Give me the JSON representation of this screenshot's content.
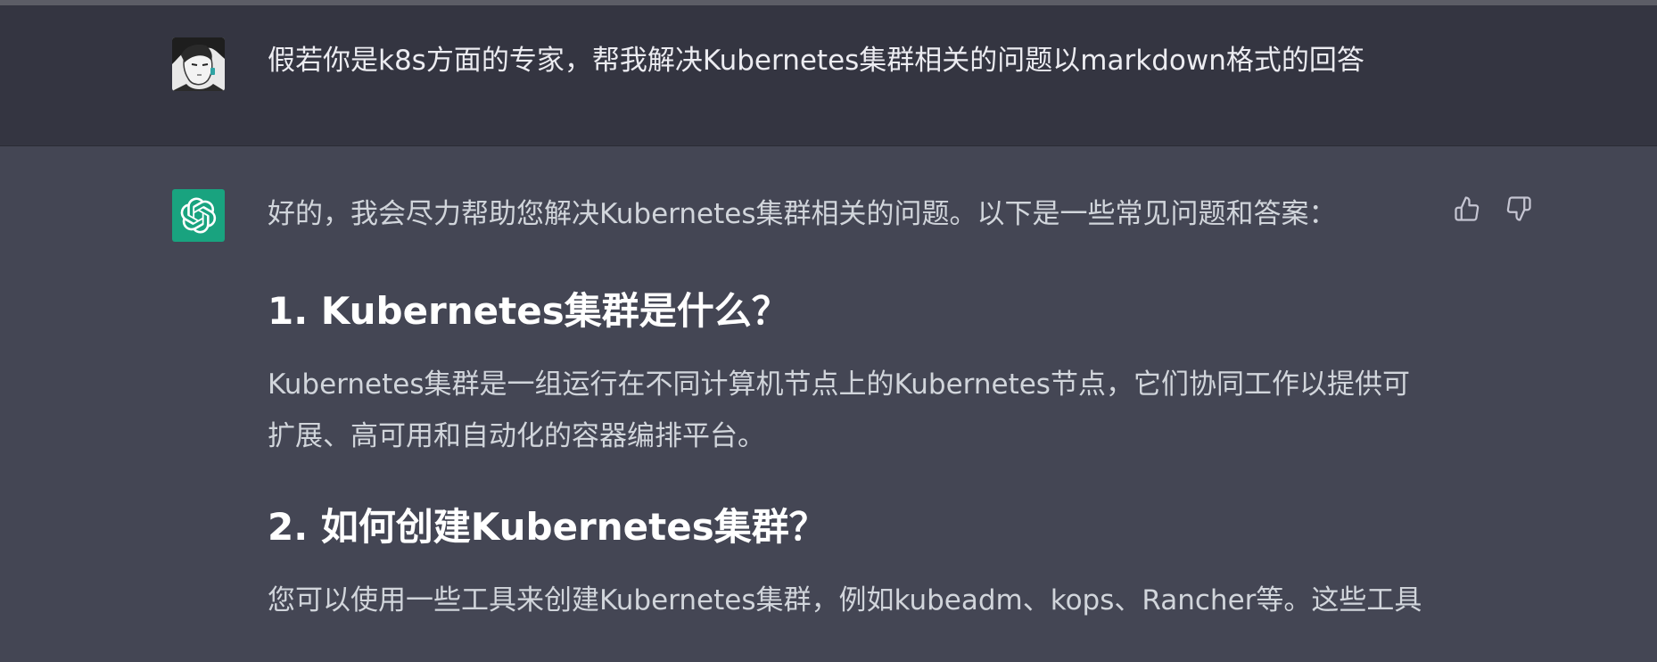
{
  "user_message": {
    "text": "假若你是k8s方面的专家，帮我解决Kubernetes集群相关的问题以markdown格式的回答"
  },
  "assistant_message": {
    "intro": "好的，我会尽力帮助您解决Kubernetes集群相关的问题。以下是一些常见问题和答案：",
    "sections": [
      {
        "heading": "1. Kubernetes集群是什么？",
        "body": "Kubernetes集群是一组运行在不同计算机节点上的Kubernetes节点，它们协同工作以提供可扩展、高可用和自动化的容器编排平台。"
      },
      {
        "heading": "2. 如何创建Kubernetes集群？",
        "body": "您可以使用一些工具来创建Kubernetes集群，例如kubeadm、kops、Rancher等。这些工具"
      }
    ]
  },
  "icons": {
    "gpt_avatar": "openai-logo-icon",
    "thumbs_up": "thumbs-up-icon",
    "thumbs_down": "thumbs-down-icon"
  },
  "colors": {
    "user_row_bg": "#343541",
    "assistant_row_bg": "#444654",
    "gpt_avatar_bg": "#19a37f"
  }
}
